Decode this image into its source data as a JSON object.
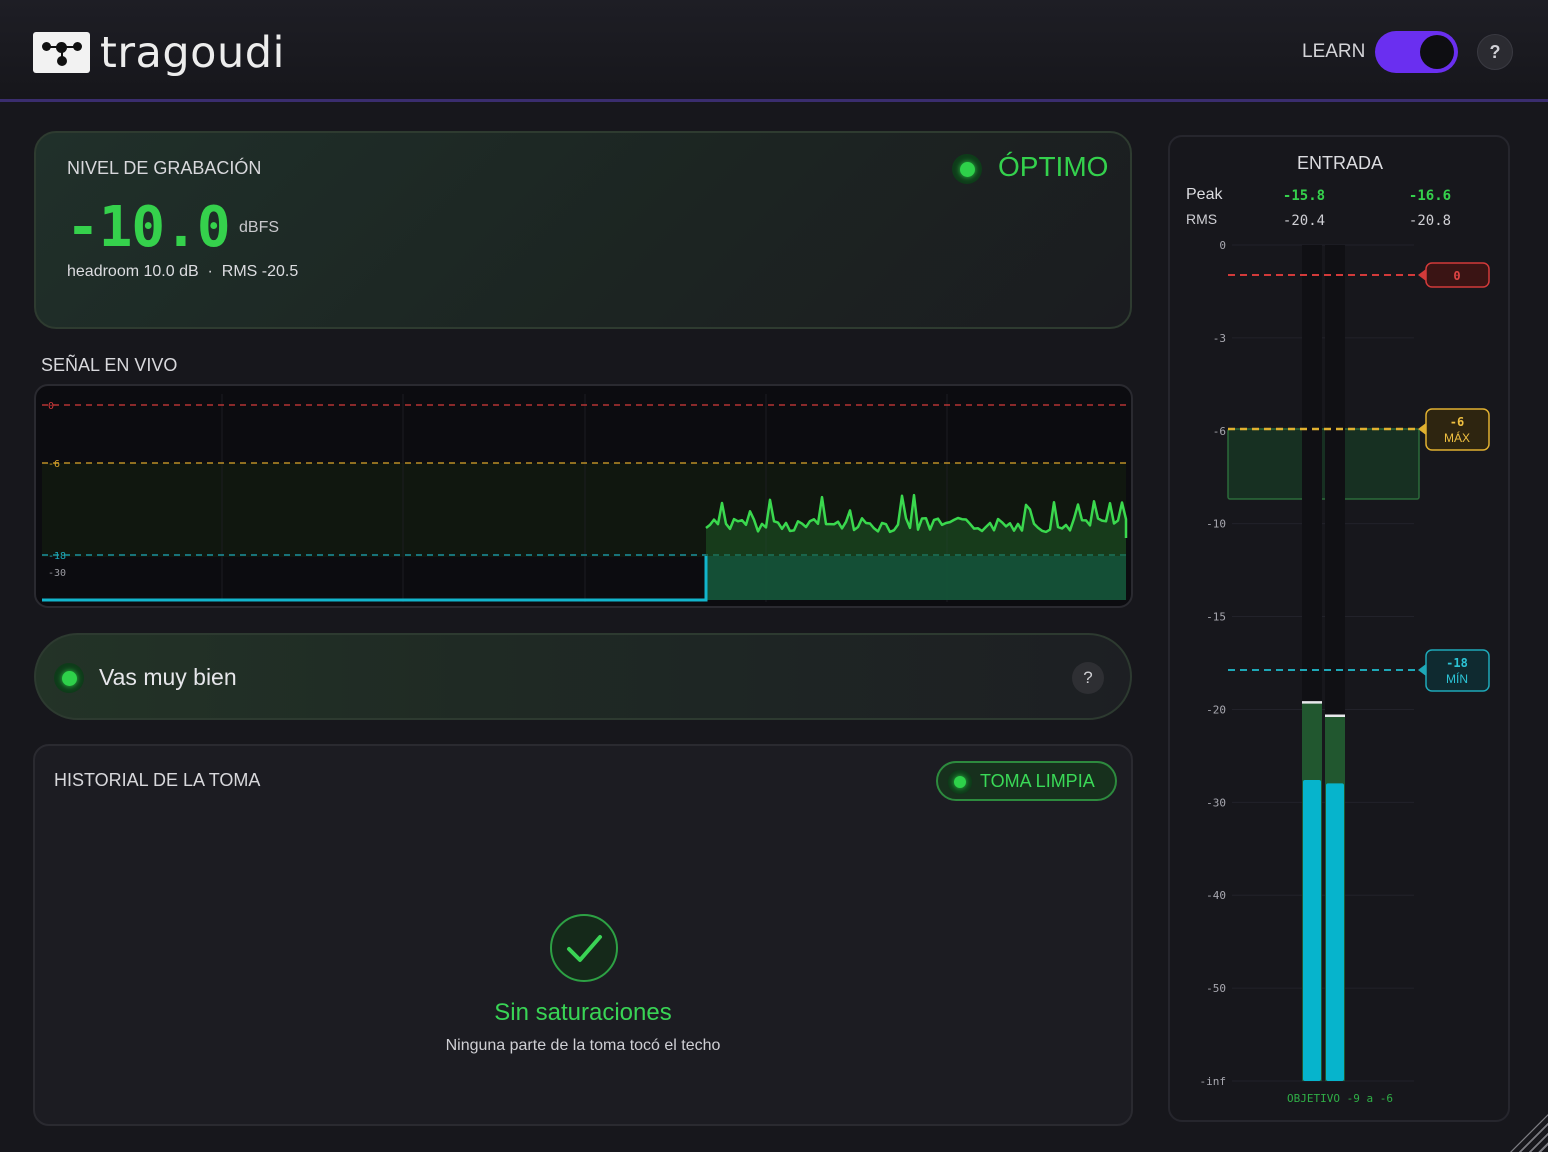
{
  "app": {
    "name": "tragoudi"
  },
  "header": {
    "learn_label": "LEARN",
    "learn_on": true,
    "help_label": "?"
  },
  "level": {
    "title": "NIVEL DE GRABACIÓN",
    "value": "-10.0",
    "unit": "dBFS",
    "sub": "headroom 10.0 dB  ·  RMS -20.5",
    "status": "ÓPTIMO"
  },
  "live": {
    "title": "SEÑAL EN VIVO",
    "lines": [
      {
        "label": "0",
        "db": 0,
        "color": "#d23a3a"
      },
      {
        "label": "-6",
        "db": -6,
        "color": "#d8a32a"
      },
      {
        "label": "-18",
        "db": -18,
        "color": "#1ea8b8"
      },
      {
        "label": "-30",
        "db": -30,
        "color": "#9a9aa0"
      }
    ]
  },
  "feedback": {
    "message": "Vas muy bien",
    "help_label": "?"
  },
  "history": {
    "title": "HISTORIAL DE LA TOMA",
    "badge": "TOMA LIMPIA",
    "main": "Sin saturaciones",
    "sub": "Ninguna parte de la toma tocó el techo"
  },
  "meter": {
    "title": "ENTRADA",
    "peak_label": "Peak",
    "rms_label": "RMS",
    "peak_l": "-15.8",
    "peak_r": "-16.6",
    "rms_l": "-20.4",
    "rms_r": "-20.8",
    "scale": [
      "0",
      "-3",
      "-6",
      "-10",
      "-15",
      "-20",
      "-30",
      "-40",
      "-50",
      "-inf"
    ],
    "ceiling_label": "0",
    "max_value": "-6",
    "max_label": "MÁX",
    "min_value": "-18",
    "min_label": "MÍN",
    "target": "OBJETIVO -9 a -6",
    "peak_fraction_l": 0.452,
    "peak_fraction_r": 0.436,
    "rms_fraction_l": 0.36,
    "rms_fraction_r": 0.356
  },
  "colors": {
    "green": "#35d14c",
    "cyan": "#06b4cc",
    "red": "#d23a3a",
    "amber": "#d8a32a",
    "accent": "#6a2ff0"
  }
}
